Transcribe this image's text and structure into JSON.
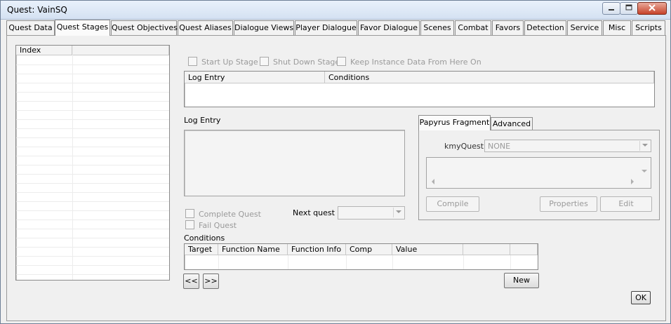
{
  "window": {
    "title": "Quest: VainSQ"
  },
  "tabs": [
    {
      "label": "Quest Data"
    },
    {
      "label": "Quest Stages"
    },
    {
      "label": "Quest Objectives"
    },
    {
      "label": "Quest Aliases"
    },
    {
      "label": "Dialogue Views"
    },
    {
      "label": "Player Dialogue"
    },
    {
      "label": "Favor Dialogue"
    },
    {
      "label": "Scenes"
    },
    {
      "label": "Combat"
    },
    {
      "label": "Favors"
    },
    {
      "label": "Detection"
    },
    {
      "label": "Service"
    },
    {
      "label": "Misc"
    },
    {
      "label": "Scripts"
    }
  ],
  "stage_list": {
    "header": "Index"
  },
  "options": {
    "start_up": "Start Up Stage",
    "shut_down": "Shut Down Stage",
    "keep_instance": "Keep Instance Data From Here On"
  },
  "log_table": {
    "col1": "Log Entry",
    "col2": "Conditions"
  },
  "log_entry": {
    "label": "Log Entry"
  },
  "complete_quest": "Complete Quest",
  "fail_quest": "Fail Quest",
  "next_quest": {
    "label": "Next quest",
    "value": ""
  },
  "conditions": {
    "label": "Conditions",
    "columns": [
      "Target",
      "Function Name",
      "Function Info",
      "Comp",
      "Value",
      "",
      ""
    ]
  },
  "nav": {
    "prev": "<<",
    "next": ">>",
    "new": "New"
  },
  "papyrus": {
    "tab_fragment": "Papyrus Fragment",
    "tab_advanced": "Advanced",
    "kmy_label": "kmyQuest",
    "kmy_value": "NONE",
    "compile": "Compile",
    "properties": "Properties",
    "edit": "Edit"
  },
  "ok": "OK"
}
